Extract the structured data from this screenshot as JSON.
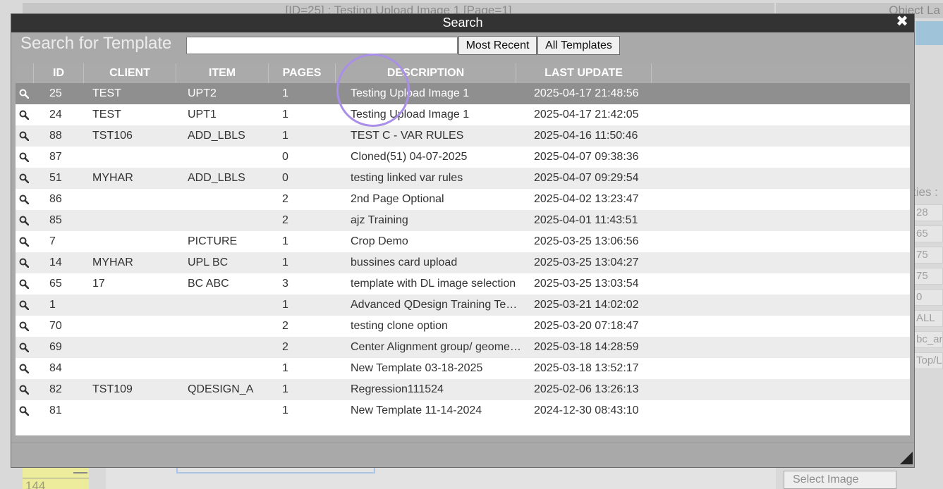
{
  "background": {
    "top_title": "[ID=25] : Testing Upload Image 1 [Page=1]",
    "right_header": "Object La",
    "right_label": "ties :",
    "right_values": [
      "28",
      "65",
      "75",
      "75",
      "0",
      "ALL",
      "bc_ar",
      "Top/L"
    ],
    "bottom_number": "144",
    "select_image_label": "Select Image"
  },
  "modal": {
    "title": "Search",
    "close_glyph": "✖",
    "search_label": "Search for Template",
    "search_value": "",
    "most_recent_label": "Most Recent",
    "all_templates_label": "All Templates"
  },
  "grid": {
    "columns": {
      "id": "ID",
      "client": "CLIENT",
      "item": "ITEM",
      "pages": "PAGES",
      "description": "DESCRIPTION",
      "last_update": "LAST UPDATE"
    },
    "rows": [
      {
        "id": "25",
        "client": "TEST",
        "item": "UPT2",
        "pages": "1",
        "description": "Testing Upload Image 1",
        "last_update": "2025-04-17 21:48:56",
        "selected": true
      },
      {
        "id": "24",
        "client": "TEST",
        "item": "UPT1",
        "pages": "1",
        "description": "Testing Upload Image 1",
        "last_update": "2025-04-17 21:42:05"
      },
      {
        "id": "88",
        "client": "TST106",
        "item": "ADD_LBLS",
        "pages": "1",
        "description": "TEST C - VAR RULES",
        "last_update": "2025-04-16 11:50:46"
      },
      {
        "id": "87",
        "client": "",
        "item": "",
        "pages": "0",
        "description": "Cloned(51) 04-07-2025",
        "last_update": "2025-04-07 09:38:36"
      },
      {
        "id": "51",
        "client": "MYHAR",
        "item": "ADD_LBLS",
        "pages": "0",
        "description": "testing linked var rules",
        "last_update": "2025-04-07 09:29:54"
      },
      {
        "id": "86",
        "client": "",
        "item": "",
        "pages": "2",
        "description": "2nd Page Optional",
        "last_update": "2025-04-02 13:23:47"
      },
      {
        "id": "85",
        "client": "",
        "item": "",
        "pages": "2",
        "description": "ajz Training",
        "last_update": "2025-04-01 11:43:51"
      },
      {
        "id": "7",
        "client": "",
        "item": "PICTURE",
        "pages": "1",
        "description": "Crop Demo",
        "last_update": "2025-03-25 13:06:56"
      },
      {
        "id": "14",
        "client": "MYHAR",
        "item": "UPL BC",
        "pages": "1",
        "description": "bussines card upload",
        "last_update": "2025-03-25 13:04:27"
      },
      {
        "id": "65",
        "client": "17",
        "item": "BC ABC",
        "pages": "3",
        "description": "template with DL image selection",
        "last_update": "2025-03-25 13:03:54"
      },
      {
        "id": "1",
        "client": "",
        "item": "",
        "pages": "1",
        "description": "Advanced QDesign Training Te…",
        "last_update": "2025-03-21 14:02:02"
      },
      {
        "id": "70",
        "client": "",
        "item": "",
        "pages": "2",
        "description": "testing clone option",
        "last_update": "2025-03-20 07:18:47"
      },
      {
        "id": "69",
        "client": "",
        "item": "",
        "pages": "2",
        "description": "Center Alignment group/ geome…",
        "last_update": "2025-03-18 14:28:59"
      },
      {
        "id": "84",
        "client": "",
        "item": "",
        "pages": "1",
        "description": "New Template 03-18-2025",
        "last_update": "2025-03-18 13:52:17"
      },
      {
        "id": "82",
        "client": "TST109",
        "item": "QDESIGN_A",
        "pages": "1",
        "description": "Regression111524",
        "last_update": "2025-02-06 13:26:13"
      },
      {
        "id": "81",
        "client": "",
        "item": "",
        "pages": "1",
        "description": "New Template 11-14-2024",
        "last_update": "2024-12-30 08:43:10"
      }
    ]
  },
  "icons": {
    "row_action": "magnifier-icon",
    "close": "close-icon",
    "resize": "resize-grip-icon"
  },
  "colors": {
    "titlebar": "#333333",
    "header": "#aaaaaa",
    "selected_row": "#8f8f8f",
    "highlight_ring": "#a98fe8"
  }
}
